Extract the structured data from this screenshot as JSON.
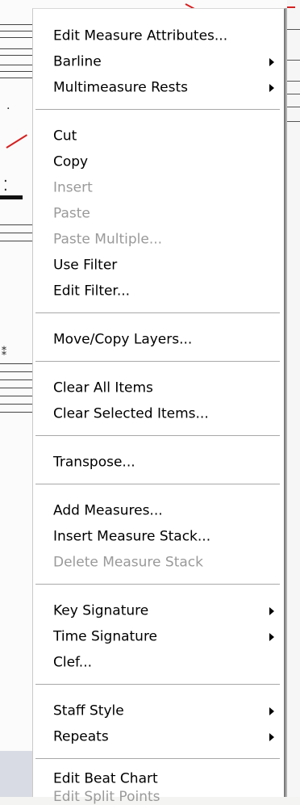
{
  "menu": {
    "groups": [
      {
        "items": [
          {
            "label": "Edit Measure Attributes...",
            "enabled": true,
            "submenu": false
          },
          {
            "label": "Barline",
            "enabled": true,
            "submenu": true
          },
          {
            "label": "Multimeasure Rests",
            "enabled": true,
            "submenu": true
          }
        ]
      },
      {
        "items": [
          {
            "label": "Cut",
            "enabled": true,
            "submenu": false
          },
          {
            "label": "Copy",
            "enabled": true,
            "submenu": false
          },
          {
            "label": "Insert",
            "enabled": false,
            "submenu": false
          },
          {
            "label": "Paste",
            "enabled": false,
            "submenu": false
          },
          {
            "label": "Paste Multiple...",
            "enabled": false,
            "submenu": false
          },
          {
            "label": "Use Filter",
            "enabled": true,
            "submenu": false
          },
          {
            "label": "Edit Filter...",
            "enabled": true,
            "submenu": false
          }
        ]
      },
      {
        "items": [
          {
            "label": "Move/Copy Layers...",
            "enabled": true,
            "submenu": false
          }
        ]
      },
      {
        "items": [
          {
            "label": "Clear All Items",
            "enabled": true,
            "submenu": false
          },
          {
            "label": "Clear Selected Items...",
            "enabled": true,
            "submenu": false
          }
        ]
      },
      {
        "items": [
          {
            "label": "Transpose...",
            "enabled": true,
            "submenu": false
          }
        ]
      },
      {
        "items": [
          {
            "label": "Add Measures...",
            "enabled": true,
            "submenu": false
          },
          {
            "label": "Insert Measure Stack...",
            "enabled": true,
            "submenu": false
          },
          {
            "label": "Delete Measure Stack",
            "enabled": false,
            "submenu": false
          }
        ]
      },
      {
        "items": [
          {
            "label": "Key Signature",
            "enabled": true,
            "submenu": true
          },
          {
            "label": "Time Signature",
            "enabled": true,
            "submenu": true
          },
          {
            "label": "Clef...",
            "enabled": true,
            "submenu": false
          }
        ]
      },
      {
        "items": [
          {
            "label": "Staff Style",
            "enabled": true,
            "submenu": true
          },
          {
            "label": "Repeats",
            "enabled": true,
            "submenu": true
          }
        ]
      },
      {
        "items": [
          {
            "label": "Edit Beat Chart",
            "enabled": true,
            "submenu": false
          },
          {
            "label": "Edit Split Points",
            "enabled": false,
            "submenu": false
          }
        ]
      }
    ]
  },
  "colors": {
    "menu_background": "#ffffff",
    "text": "#000000",
    "disabled_text": "#9a9a9a",
    "separator": "#a8a8a8",
    "annotation_red": "#d62020"
  },
  "icons": {
    "submenu": "submenu-arrow-icon"
  }
}
